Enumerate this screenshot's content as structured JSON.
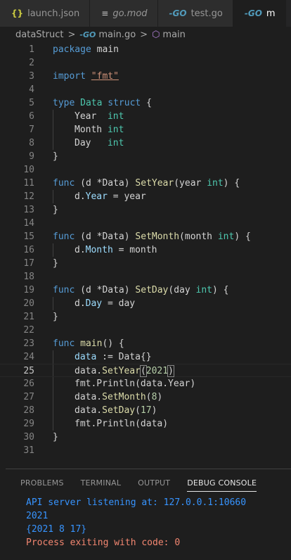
{
  "tabs": [
    {
      "icon": "json-icon",
      "glyph": "{}",
      "label": "launch.json"
    },
    {
      "icon": "mod-icon",
      "glyph": "≡",
      "label": "go.mod"
    },
    {
      "icon": "go-icon",
      "glyph": "-GO",
      "label": "test.go"
    },
    {
      "icon": "go-icon",
      "glyph": "-GO",
      "label": "m"
    }
  ],
  "breadcrumb": {
    "folder": "dataStruct",
    "file": "main.go",
    "symbol": "main",
    "separator": ">",
    "go_glyph": "-GO",
    "cube_glyph": "⬡"
  },
  "editor": {
    "current_line": 25,
    "line_numbers": [
      "1",
      "2",
      "3",
      "4",
      "5",
      "6",
      "7",
      "8",
      "9",
      "10",
      "11",
      "12",
      "13",
      "14",
      "15",
      "16",
      "17",
      "18",
      "19",
      "20",
      "21",
      "22",
      "23",
      "24",
      "25",
      "26",
      "27",
      "28",
      "29",
      "30",
      "31"
    ],
    "tokens": {
      "package": "package",
      "main_pkg": "main",
      "import": "import",
      "fmt_str": "\"fmt\"",
      "type": "type",
      "Data": "Data",
      "struct": "struct",
      "lbrace": "{",
      "rbrace": "}",
      "Year": "Year",
      "Month": "Month",
      "Day": "Day",
      "int": "int",
      "func": "func",
      "recv": "(d *Data)",
      "SetYear": "SetYear",
      "SetMonth": "SetMonth",
      "SetDay": "SetDay",
      "p_year": "(year ",
      "p_month": "(month ",
      "p_day": "(day ",
      "close_brace_open": ") {",
      "d_dot": "d.",
      "assign": " = ",
      "year": "year",
      "month": "month",
      "day": "day",
      "main_fn": "main",
      "main_parens": "() {",
      "data": "data",
      "decl": " := Data{}",
      "data_dot": "data.",
      "lparen": "(",
      "rparen": ")",
      "n2021": "2021",
      "n8": "8",
      "n17": "17",
      "fmt_println": "fmt.Println",
      "arg_data_year": "(data.Year)",
      "arg_data": "(data)"
    }
  },
  "panel": {
    "tabs": [
      "PROBLEMS",
      "TERMINAL",
      "OUTPUT",
      "DEBUG CONSOLE"
    ],
    "active_tab": "DEBUG CONSOLE",
    "output": [
      {
        "text": "API server listening at: 127.0.0.1:10660",
        "color": "#3794ff"
      },
      {
        "text": "2021",
        "color": "#3794ff"
      },
      {
        "text": "{2021 8 17}",
        "color": "#3794ff"
      },
      {
        "text": "Process exiting with code: 0",
        "color": "#f48771"
      }
    ]
  }
}
